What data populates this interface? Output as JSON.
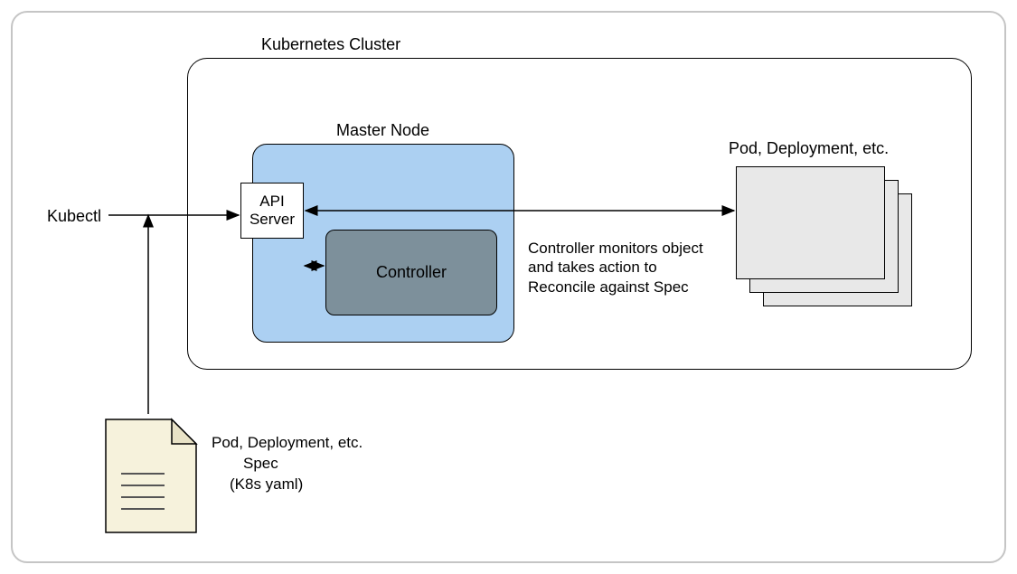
{
  "diagram": {
    "title": "Kubernetes Cluster",
    "kubectl": "Kubectl",
    "master_node": {
      "title": "Master Node",
      "api_server": "API\nServer",
      "controller": "Controller"
    },
    "controller_description": "Controller monitors object and takes action to Reconcile against Spec",
    "pods": {
      "title": "Pod, Deployment, etc."
    },
    "spec_file": {
      "line1": "Pod, Deployment, etc.",
      "line2": "Spec",
      "line3": "(K8s yaml)"
    }
  }
}
